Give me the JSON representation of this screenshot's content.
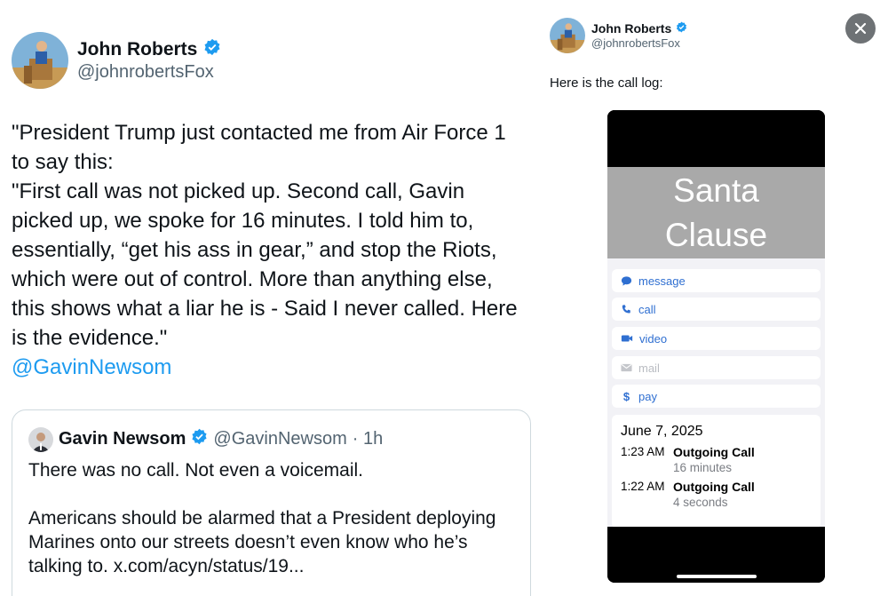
{
  "tweet": {
    "author_name": "John Roberts",
    "author_handle": "@johnrobertsFox",
    "text_lines": [
      "\"President Trump just contacted me from Air Force 1",
      "to say this:",
      "\"First call was not picked up. Second call, Gavin",
      "picked up, we spoke for 16 minutes. I told him to,",
      "essentially, “get his ass in gear,” and stop the Riots,",
      "which were out of control. More than anything else,",
      "this shows what a liar he is - Said I never called. Here",
      "is the evidence.\""
    ],
    "mention": "@GavinNewsom"
  },
  "quoted_tweet": {
    "author_name": "Gavin Newsom",
    "author_handle": "@GavinNewsom",
    "time": "· 1h",
    "line1": "There was no call. Not even a voicemail.",
    "line2": "Americans should be alarmed that a President deploying",
    "line3": "Marines onto our streets doesn’t even know who he’s",
    "line4": "talking to. x.com/acyn/status/19..."
  },
  "media_viewer": {
    "author_name": "John Roberts",
    "author_handle": "@johnrobertsFox",
    "caption": "Here is the call log:",
    "close_icon": "close-icon"
  },
  "phone": {
    "contact_name_line1": "Santa",
    "contact_name_line2": "Clause",
    "actions": [
      {
        "label": "message",
        "icon": "message-icon"
      },
      {
        "label": "call",
        "icon": "phone-icon"
      },
      {
        "label": "video",
        "icon": "video-icon"
      },
      {
        "label": "mail",
        "icon": "mail-icon"
      },
      {
        "label": "pay",
        "icon": "dollar-icon"
      }
    ],
    "log_date": "June 7, 2025",
    "calls": [
      {
        "time": "1:23 AM",
        "type": "Outgoing Call",
        "duration": "16 minutes"
      },
      {
        "time": "1:22 AM",
        "type": "Outgoing Call",
        "duration": "4 seconds"
      }
    ]
  },
  "colors": {
    "link": "#1d9bf0",
    "verified": "#1d9bf0",
    "ios_blue": "#2f6fd1",
    "contact_banner": "#a9a9a9"
  }
}
